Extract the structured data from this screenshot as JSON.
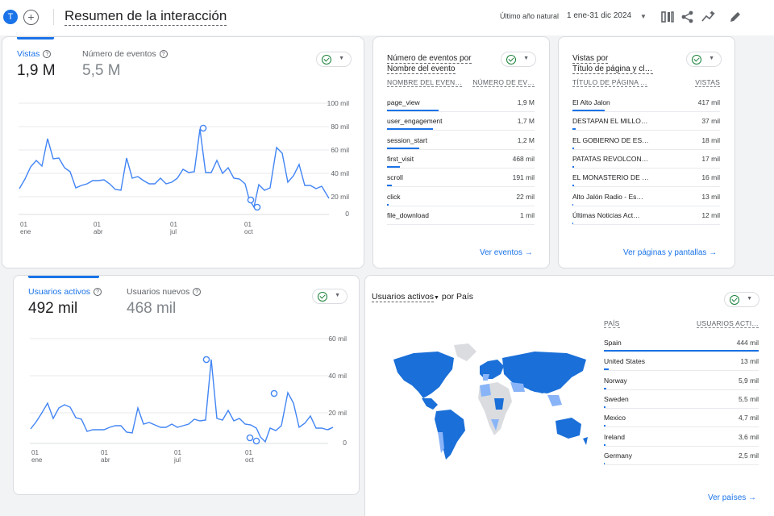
{
  "header": {
    "avatar_letter": "T",
    "add_symbol": "+",
    "title": "Resumen de la interacción",
    "range_label": "Último año natural",
    "range_value": "1 ene-31 dic 2024",
    "icons": [
      "compare-icon",
      "share-icon",
      "insights-icon",
      "edit-icon"
    ]
  },
  "card1": {
    "metric1_label": "Vistas",
    "metric1_value": "1,9 M",
    "metric2_label": "Número de eventos",
    "metric2_value": "5,5 M",
    "y_ticks": [
      "100 mil",
      "80 mil",
      "60 mil",
      "40 mil",
      "20 mil",
      "0"
    ],
    "x_ticks": [
      [
        "01",
        "ene"
      ],
      [
        "01",
        "abr"
      ],
      [
        "01",
        "jul"
      ],
      [
        "01",
        "oct"
      ]
    ]
  },
  "card2": {
    "title_line1": "Número de eventos por",
    "title_line2": "Nombre del evento",
    "col1": "NOMBRE DEL EVEN…",
    "col2": "NÚMERO DE EV…",
    "rows": [
      {
        "k": "page_view",
        "v": "1,9 M",
        "pct": 0.35
      },
      {
        "k": "user_engagement",
        "v": "1,7 M",
        "pct": 0.31
      },
      {
        "k": "session_start",
        "v": "1,2 M",
        "pct": 0.22
      },
      {
        "k": "first_visit",
        "v": "468 mil",
        "pct": 0.085
      },
      {
        "k": "scroll",
        "v": "191 mil",
        "pct": 0.035
      },
      {
        "k": "click",
        "v": "22 mil",
        "pct": 0.01
      },
      {
        "k": "file_download",
        "v": "1 mil",
        "pct": 0
      }
    ],
    "link": "Ver eventos"
  },
  "card3": {
    "title_line1": "Vistas por",
    "title_line2": "Título de página y cl…",
    "col1": "TÍTULO DE PÁGINA …",
    "col2": "VISTAS",
    "rows": [
      {
        "k": "El Alto Jalon",
        "v": "417 mil",
        "pct": 0.22
      },
      {
        "k": "DESTAPAN EL MILLO…",
        "v": "37 mil",
        "pct": 0.02
      },
      {
        "k": "EL GOBIERNO DE ES…",
        "v": "18 mil",
        "pct": 0.01
      },
      {
        "k": "PATATAS REVOLCON…",
        "v": "17 mil",
        "pct": 0.01
      },
      {
        "k": "EL MONASTERIO DE …",
        "v": "16 mil",
        "pct": 0.01
      },
      {
        "k": "Alto Jalón Radio - Es…",
        "v": "13 mil",
        "pct": 0.007
      },
      {
        "k": "Últimas Noticias Act…",
        "v": "12 mil",
        "pct": 0.006
      }
    ],
    "link": "Ver páginas y pantallas"
  },
  "card4": {
    "metric1_label": "Usuarios activos",
    "metric1_value": "492 mil",
    "metric2_label": "Usuarios nuevos",
    "metric2_value": "468 mil",
    "y_ticks": [
      "60 mil",
      "40 mil",
      "20 mil",
      "0"
    ],
    "x_ticks": [
      [
        "01",
        "ene"
      ],
      [
        "01",
        "abr"
      ],
      [
        "01",
        "jul"
      ],
      [
        "01",
        "oct"
      ]
    ]
  },
  "card5": {
    "title_metric": "Usuarios activos",
    "title_rest": "por País",
    "col1": "PAÍS",
    "col2": "USUARIOS ACTI…",
    "rows": [
      {
        "k": "Spain",
        "v": "444 mil",
        "pct": 1.0
      },
      {
        "k": "United States",
        "v": "13 mil",
        "pct": 0.03
      },
      {
        "k": "Norway",
        "v": "5,9 mil",
        "pct": 0.015
      },
      {
        "k": "Sweden",
        "v": "5,5 mil",
        "pct": 0.013
      },
      {
        "k": "Mexico",
        "v": "4,7 mil",
        "pct": 0.011
      },
      {
        "k": "Ireland",
        "v": "3,6 mil",
        "pct": 0.008
      },
      {
        "k": "Germany",
        "v": "2,5 mil",
        "pct": 0.006
      }
    ],
    "link": "Ver países"
  },
  "colors": {
    "accent": "#1a73e8",
    "ok": "#188038",
    "map_dark": "#1a6fd8",
    "map_light": "#8ab4f8",
    "map_none": "#dadce0"
  }
}
